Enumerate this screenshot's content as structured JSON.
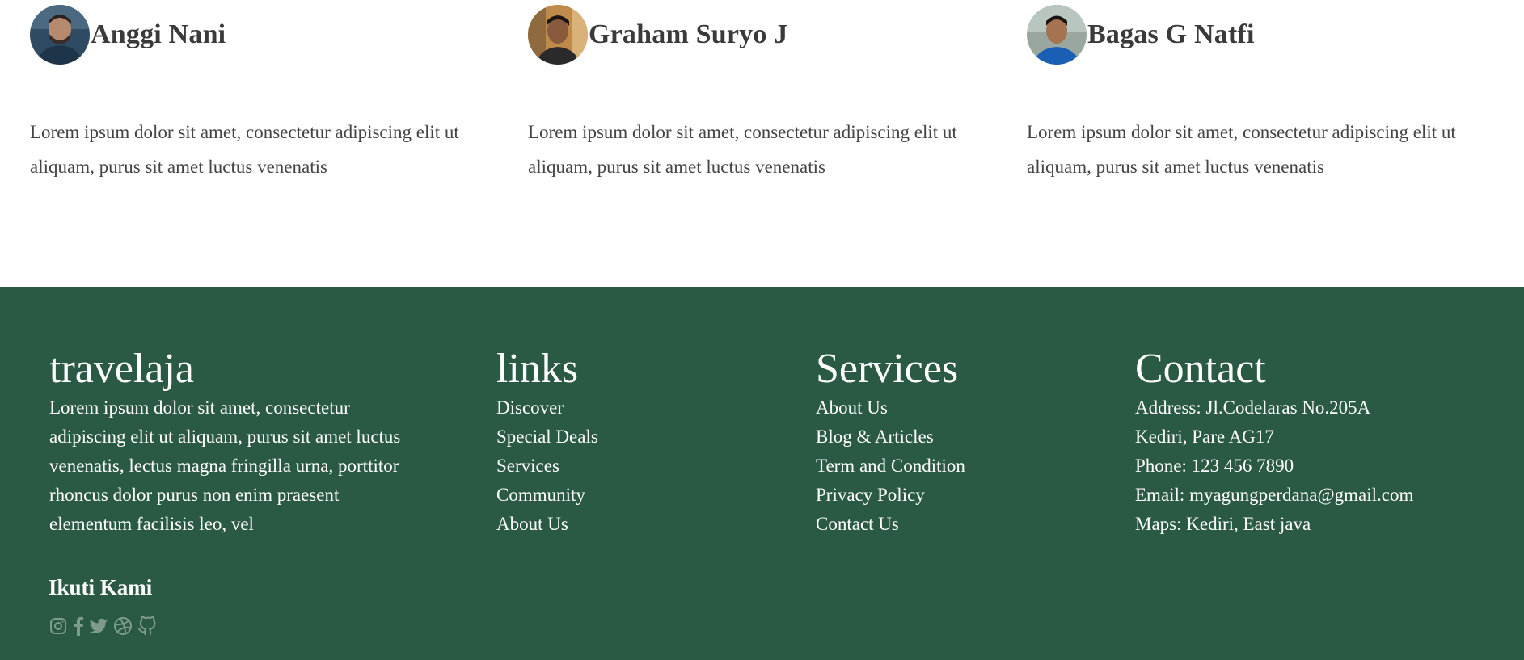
{
  "testimonials": [
    {
      "name": "Anggi Nani",
      "text": "Lorem ipsum dolor sit amet, consectetur adipiscing elit ut aliquam, purus sit amet luctus venenatis"
    },
    {
      "name": "Graham Suryo J",
      "text": "Lorem ipsum dolor sit amet, consectetur adipiscing elit ut aliquam, purus sit amet luctus venenatis"
    },
    {
      "name": "Bagas G Natfi",
      "text": "Lorem ipsum dolor sit amet, consectetur adipiscing elit ut aliquam, purus sit amet luctus venenatis"
    }
  ],
  "footer": {
    "brand": {
      "title": "travelaja",
      "description": "Lorem ipsum dolor sit amet, consectetur adipiscing elit ut aliquam, purus sit amet luctus venenatis, lectus magna fringilla urna, porttitor rhoncus dolor purus non enim praesent elementum facilisis leo, vel"
    },
    "links": {
      "title": "links",
      "items": [
        "Discover",
        "Special Deals",
        "Services",
        "Community",
        "About Us"
      ]
    },
    "services": {
      "title": "Services",
      "items": [
        "About Us",
        "Blog & Articles",
        "Term and Condition",
        "Privacy Policy",
        "Contact Us"
      ]
    },
    "contact": {
      "title": "Contact",
      "items": [
        "Address: Jl.Codelaras No.205A",
        "Kediri, Pare AG17",
        "Phone: 123 456 7890",
        "Email: myagungperdana@gmail.com",
        "Maps: Kediri, East java"
      ]
    },
    "follow_title": "Ikuti Kami",
    "social_icons": [
      "instagram-icon",
      "facebook-icon",
      "twitter-icon",
      "dribbble-icon",
      "github-icon"
    ],
    "colors": {
      "background": "#2a5a44",
      "icon": "#7f9b8c",
      "text": "#ffffff"
    }
  }
}
